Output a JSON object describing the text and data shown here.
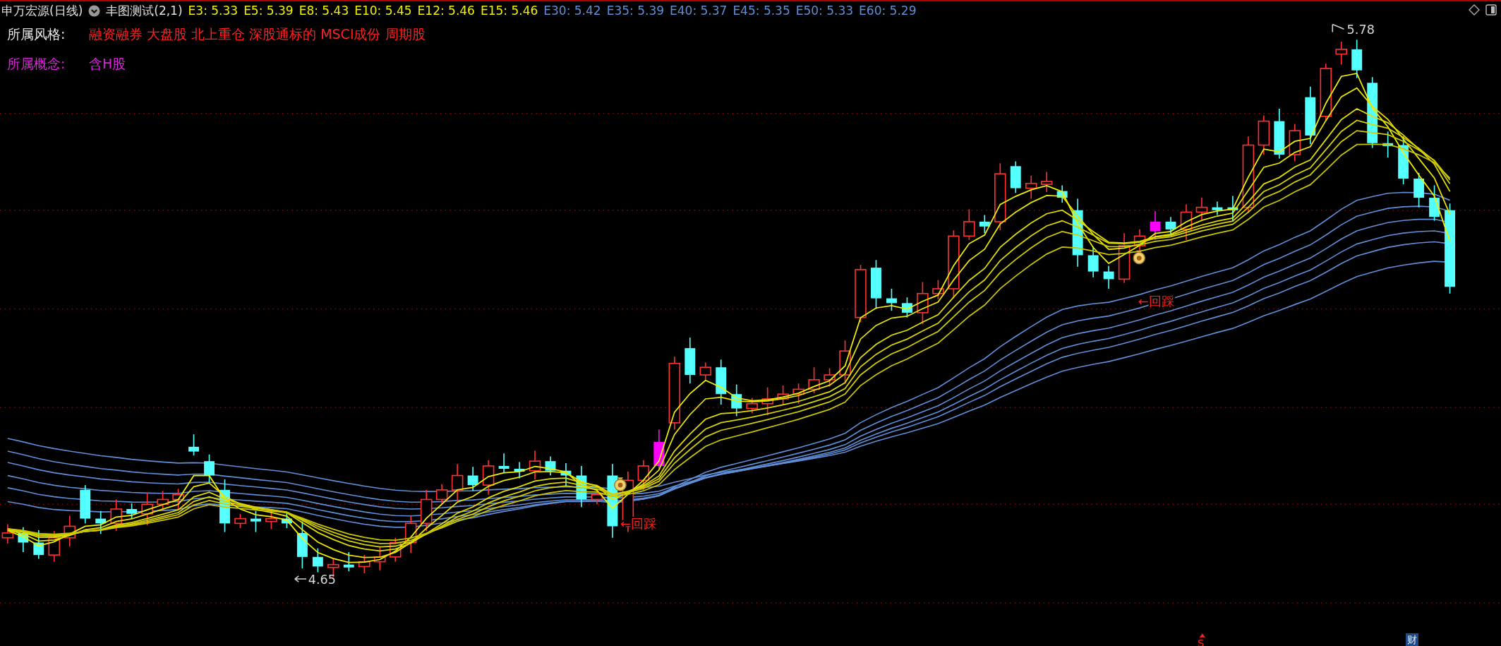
{
  "header": {
    "stock_name": "申万宏源(日线)",
    "indicator_name": "丰图测试(2,1)",
    "short_emas": [
      "E3: 5.33",
      "E5: 5.39",
      "E8: 5.43",
      "E10: 5.45",
      "E12: 5.46",
      "E15: 5.46"
    ],
    "long_emas": [
      "E30: 5.42",
      "E35: 5.39",
      "E40: 5.37",
      "E45: 5.35",
      "E50: 5.33",
      "E60: 5.29"
    ]
  },
  "style_row": {
    "label": "所属风格:",
    "value": "融资融券 大盘股 北上重仓 深股通标的 MSCI成份 周期股"
  },
  "concept_row": {
    "label": "所属概念:",
    "value": "含H股"
  },
  "chart_labels": {
    "high": "5.78",
    "low": "4.65",
    "pullback_markers": [
      "←回踩",
      "←回踩"
    ],
    "bottom_marker": "S",
    "corner_badge": "财"
  }
}
